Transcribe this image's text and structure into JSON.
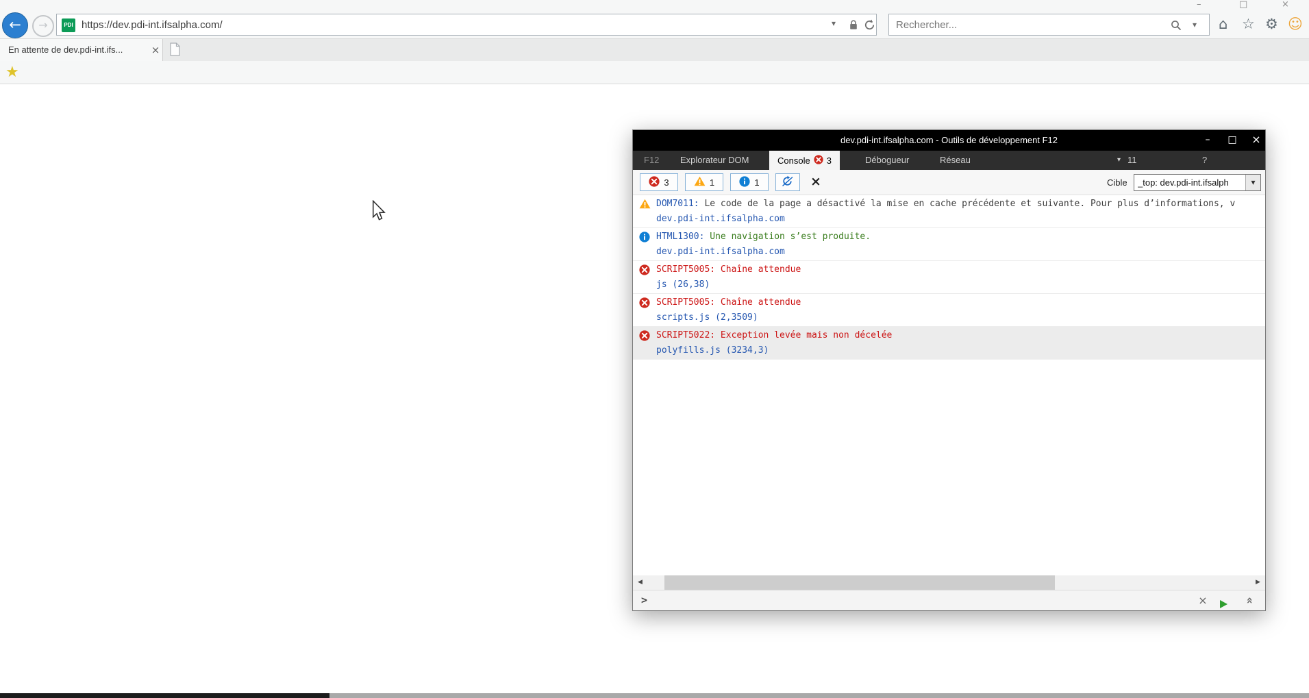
{
  "colors": {
    "error": "#ce2a1f",
    "warning": "#fca713",
    "info": "#0f7fd4",
    "accent_blue": "#2c7fd0",
    "devtools_titlebar": "#000000"
  },
  "browser": {
    "window": {
      "minimize": "–",
      "maximize": "□",
      "close": "×"
    },
    "toolbar": {
      "back": "←",
      "forward": "→",
      "url": "https://dev.pdi-int.ifsalpha.com/",
      "favicon": "PDI",
      "url_dropdown": "▾",
      "search_placeholder": "Rechercher...",
      "search_dropdown": "▾",
      "home": "⌂",
      "favorites": "☆",
      "settings": "⚙",
      "feedback": "☺"
    },
    "tabs": {
      "active_title": "En attente de dev.pdi-int.ifs...",
      "close": "×"
    },
    "favorites_bar": {
      "star": "★"
    }
  },
  "devtools": {
    "title": "dev.pdi-int.ifsalpha.com - Outils de développement F12",
    "window": {
      "minimize": "–",
      "maximize": "□",
      "close": "×"
    },
    "menu": {
      "f12": "F12",
      "dom_explorer": "Explorateur DOM",
      "console": "Console",
      "console_badge": "3",
      "debugger": "Débogueur",
      "network": "Réseau",
      "doc_mode_dropdown": "▾",
      "doc_mode": "11",
      "help": "?"
    },
    "toolbar": {
      "errors": "3",
      "warnings": "1",
      "infos": "1",
      "target_label": "Cible",
      "target_value": "_top: dev.pdi-int.ifsalph",
      "dropdown": "▾"
    },
    "console": {
      "messages": [
        {
          "type": "warning",
          "code": "DOM7011:",
          "text": " Le code de la page a désactivé la mise en cache précédente et suivante. Pour plus d’informations, v",
          "source": "dev.pdi-int.ifsalpha.com"
        },
        {
          "type": "info",
          "code": "HTML1300:",
          "text": " Une navigation s’est produite.",
          "source": "dev.pdi-int.ifsalpha.com"
        },
        {
          "type": "error",
          "code": "SCRIPT5005:",
          "text": " Chaîne attendue",
          "source": "js (26,38)"
        },
        {
          "type": "error",
          "code": "SCRIPT5005:",
          "text": " Chaîne attendue",
          "source": "scripts.js (2,3509)"
        },
        {
          "type": "error",
          "code": "SCRIPT5022:",
          "text": " Exception levée mais non décelée",
          "source": "polyfills.js (3234,3)"
        }
      ]
    },
    "scrollbar": {
      "left": "◀",
      "right": "▶"
    },
    "bottom": {
      "prompt": ">",
      "close": "×",
      "collapse": "«"
    }
  }
}
